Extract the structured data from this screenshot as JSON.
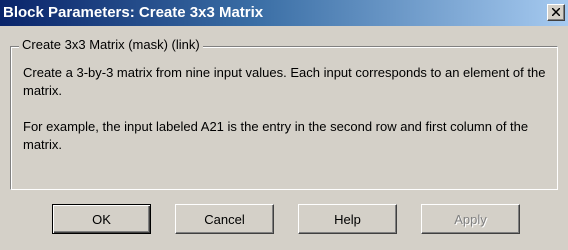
{
  "window": {
    "title": "Block Parameters: Create 3x3 Matrix",
    "colors": {
      "titlebar_start": "#0a246a",
      "titlebar_end": "#a6caf0",
      "face": "#d4d0c8"
    }
  },
  "titlebar": {
    "close_icon": "close-icon"
  },
  "group": {
    "title": "Create 3x3 Matrix (mask) (link)",
    "description_1": "Create a 3-by-3 matrix from nine input values. Each input corresponds to an element of the matrix.",
    "description_2": "For example, the input labeled A21 is the entry in the second row and first column of the matrix."
  },
  "buttons": {
    "ok": "OK",
    "cancel": "Cancel",
    "help": "Help",
    "apply": "Apply"
  }
}
